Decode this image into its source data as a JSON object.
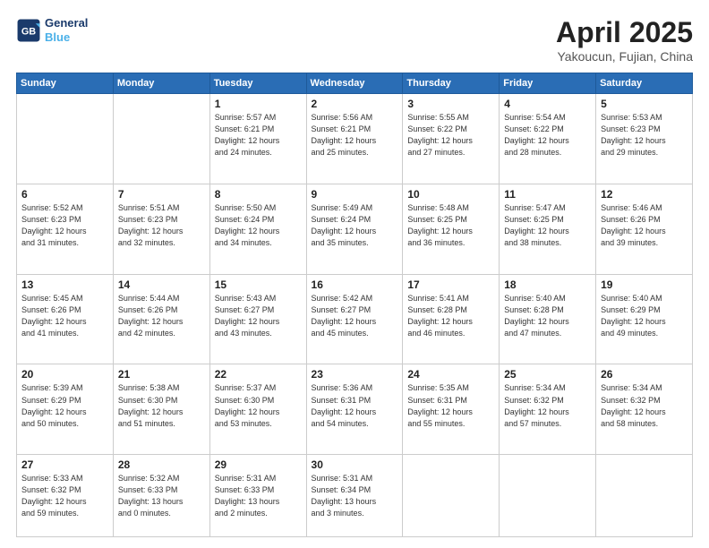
{
  "header": {
    "logo_line1": "General",
    "logo_line2": "Blue",
    "month": "April 2025",
    "location": "Yakoucun, Fujian, China"
  },
  "weekdays": [
    "Sunday",
    "Monday",
    "Tuesday",
    "Wednesday",
    "Thursday",
    "Friday",
    "Saturday"
  ],
  "weeks": [
    [
      {
        "day": "",
        "info": ""
      },
      {
        "day": "",
        "info": ""
      },
      {
        "day": "1",
        "info": "Sunrise: 5:57 AM\nSunset: 6:21 PM\nDaylight: 12 hours\nand 24 minutes."
      },
      {
        "day": "2",
        "info": "Sunrise: 5:56 AM\nSunset: 6:21 PM\nDaylight: 12 hours\nand 25 minutes."
      },
      {
        "day": "3",
        "info": "Sunrise: 5:55 AM\nSunset: 6:22 PM\nDaylight: 12 hours\nand 27 minutes."
      },
      {
        "day": "4",
        "info": "Sunrise: 5:54 AM\nSunset: 6:22 PM\nDaylight: 12 hours\nand 28 minutes."
      },
      {
        "day": "5",
        "info": "Sunrise: 5:53 AM\nSunset: 6:23 PM\nDaylight: 12 hours\nand 29 minutes."
      }
    ],
    [
      {
        "day": "6",
        "info": "Sunrise: 5:52 AM\nSunset: 6:23 PM\nDaylight: 12 hours\nand 31 minutes."
      },
      {
        "day": "7",
        "info": "Sunrise: 5:51 AM\nSunset: 6:23 PM\nDaylight: 12 hours\nand 32 minutes."
      },
      {
        "day": "8",
        "info": "Sunrise: 5:50 AM\nSunset: 6:24 PM\nDaylight: 12 hours\nand 34 minutes."
      },
      {
        "day": "9",
        "info": "Sunrise: 5:49 AM\nSunset: 6:24 PM\nDaylight: 12 hours\nand 35 minutes."
      },
      {
        "day": "10",
        "info": "Sunrise: 5:48 AM\nSunset: 6:25 PM\nDaylight: 12 hours\nand 36 minutes."
      },
      {
        "day": "11",
        "info": "Sunrise: 5:47 AM\nSunset: 6:25 PM\nDaylight: 12 hours\nand 38 minutes."
      },
      {
        "day": "12",
        "info": "Sunrise: 5:46 AM\nSunset: 6:26 PM\nDaylight: 12 hours\nand 39 minutes."
      }
    ],
    [
      {
        "day": "13",
        "info": "Sunrise: 5:45 AM\nSunset: 6:26 PM\nDaylight: 12 hours\nand 41 minutes."
      },
      {
        "day": "14",
        "info": "Sunrise: 5:44 AM\nSunset: 6:26 PM\nDaylight: 12 hours\nand 42 minutes."
      },
      {
        "day": "15",
        "info": "Sunrise: 5:43 AM\nSunset: 6:27 PM\nDaylight: 12 hours\nand 43 minutes."
      },
      {
        "day": "16",
        "info": "Sunrise: 5:42 AM\nSunset: 6:27 PM\nDaylight: 12 hours\nand 45 minutes."
      },
      {
        "day": "17",
        "info": "Sunrise: 5:41 AM\nSunset: 6:28 PM\nDaylight: 12 hours\nand 46 minutes."
      },
      {
        "day": "18",
        "info": "Sunrise: 5:40 AM\nSunset: 6:28 PM\nDaylight: 12 hours\nand 47 minutes."
      },
      {
        "day": "19",
        "info": "Sunrise: 5:40 AM\nSunset: 6:29 PM\nDaylight: 12 hours\nand 49 minutes."
      }
    ],
    [
      {
        "day": "20",
        "info": "Sunrise: 5:39 AM\nSunset: 6:29 PM\nDaylight: 12 hours\nand 50 minutes."
      },
      {
        "day": "21",
        "info": "Sunrise: 5:38 AM\nSunset: 6:30 PM\nDaylight: 12 hours\nand 51 minutes."
      },
      {
        "day": "22",
        "info": "Sunrise: 5:37 AM\nSunset: 6:30 PM\nDaylight: 12 hours\nand 53 minutes."
      },
      {
        "day": "23",
        "info": "Sunrise: 5:36 AM\nSunset: 6:31 PM\nDaylight: 12 hours\nand 54 minutes."
      },
      {
        "day": "24",
        "info": "Sunrise: 5:35 AM\nSunset: 6:31 PM\nDaylight: 12 hours\nand 55 minutes."
      },
      {
        "day": "25",
        "info": "Sunrise: 5:34 AM\nSunset: 6:32 PM\nDaylight: 12 hours\nand 57 minutes."
      },
      {
        "day": "26",
        "info": "Sunrise: 5:34 AM\nSunset: 6:32 PM\nDaylight: 12 hours\nand 58 minutes."
      }
    ],
    [
      {
        "day": "27",
        "info": "Sunrise: 5:33 AM\nSunset: 6:32 PM\nDaylight: 12 hours\nand 59 minutes."
      },
      {
        "day": "28",
        "info": "Sunrise: 5:32 AM\nSunset: 6:33 PM\nDaylight: 13 hours\nand 0 minutes."
      },
      {
        "day": "29",
        "info": "Sunrise: 5:31 AM\nSunset: 6:33 PM\nDaylight: 13 hours\nand 2 minutes."
      },
      {
        "day": "30",
        "info": "Sunrise: 5:31 AM\nSunset: 6:34 PM\nDaylight: 13 hours\nand 3 minutes."
      },
      {
        "day": "",
        "info": ""
      },
      {
        "day": "",
        "info": ""
      },
      {
        "day": "",
        "info": ""
      }
    ]
  ]
}
